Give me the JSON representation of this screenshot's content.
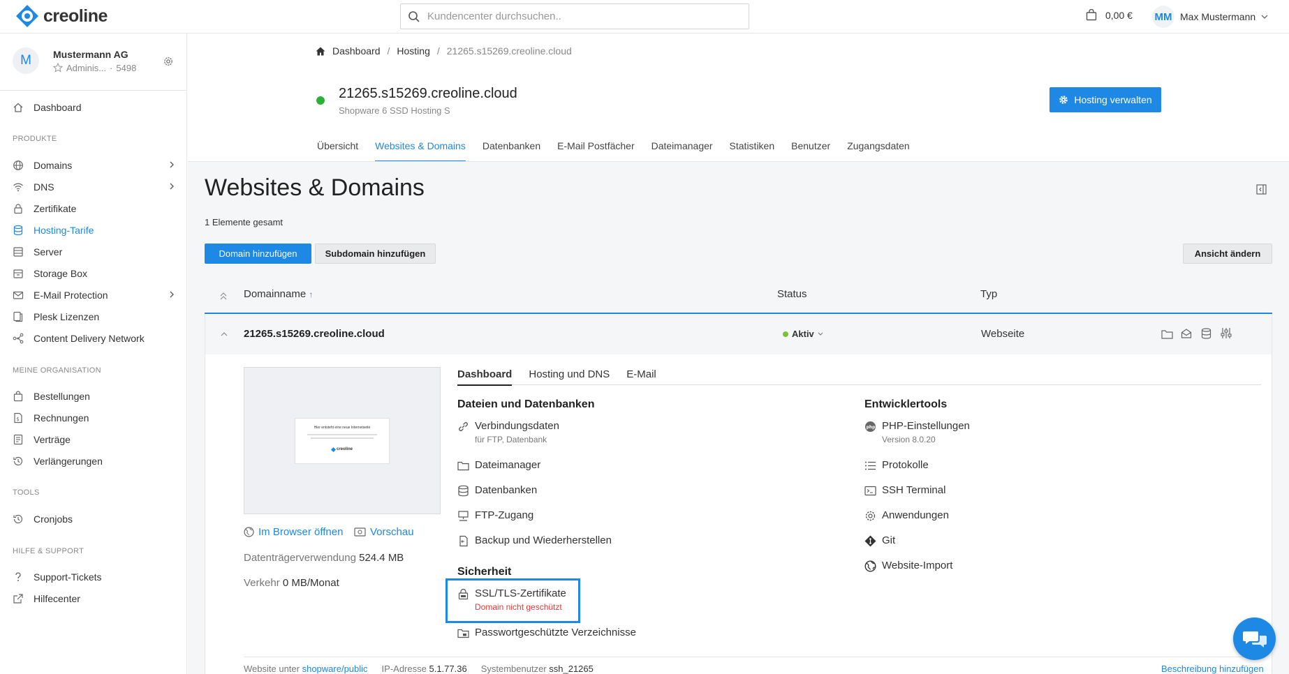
{
  "app": {
    "brand": "creoline",
    "accent": "#1e88e5"
  },
  "header": {
    "search_placeholder": "Kundencenter durchsuchen..",
    "cart_amount": "0,00 €",
    "user_initials": "MM",
    "user_name": "Max Mustermann"
  },
  "sidebar": {
    "org_initial": "M",
    "org_name": "Mustermann AG",
    "org_role": "Adminis...",
    "org_sep": "·",
    "org_id": "5498",
    "dashboard": "Dashboard",
    "section_products": "PRODUKTE",
    "domains": "Domains",
    "dns": "DNS",
    "certificates": "Zertifikate",
    "hosting": "Hosting-Tarife",
    "server": "Server",
    "storage": "Storage Box",
    "email_protection": "E-Mail Protection",
    "plesk": "Plesk Lizenzen",
    "cdn": "Content Delivery Network",
    "section_org": "MEINE ORGANISATION",
    "orders": "Bestellungen",
    "invoices": "Rechnungen",
    "contracts": "Verträge",
    "renewals": "Verlängerungen",
    "section_tools": "TOOLS",
    "cronjobs": "Cronjobs",
    "section_help": "HILFE & SUPPORT",
    "tickets": "Support-Tickets",
    "helpcenter": "Hilfecenter"
  },
  "breadcrumb": {
    "home": "Dashboard",
    "sep": "/",
    "hosting": "Hosting",
    "current": "21265.s15269.creoline.cloud"
  },
  "hosting": {
    "status_color": "#2bb039",
    "title": "21265.s15269.creoline.cloud",
    "subtitle": "Shopware 6 SSD Hosting S",
    "manage_button": "Hosting verwalten"
  },
  "tabs": [
    "Übersicht",
    "Websites & Domains",
    "Datenbanken",
    "E-Mail Postfächer",
    "Dateimanager",
    "Statistiken",
    "Benutzer",
    "Zugangsdaten"
  ],
  "page": {
    "title": "Websites & Domains",
    "count": "1 Elemente gesamt",
    "add_domain": "Domain hinzufügen",
    "add_subdomain": "Subdomain hinzufügen",
    "change_view": "Ansicht ändern"
  },
  "table": {
    "col_domain": "Domainname",
    "sort_arrow": "↑",
    "col_status": "Status",
    "col_type": "Typ",
    "row": {
      "domain": "21265.s15269.creoline.cloud",
      "status": "Aktiv",
      "type": "Webseite"
    }
  },
  "preview": {
    "card_title": "Hier entsteht eine neue Internetseite",
    "card_brand": "creoline"
  },
  "links": {
    "open_browser": "Im Browser öffnen",
    "preview": "Vorschau",
    "disk_label": "Datenträgerverwendung",
    "disk_value": "524.4 MB",
    "traffic_label": "Verkehr",
    "traffic_value": "0 MB/Monat"
  },
  "detail_tabs": [
    "Dashboard",
    "Hosting und DNS",
    "E-Mail"
  ],
  "files_section": {
    "title": "Dateien und Datenbanken",
    "connection": "Verbindungsdaten",
    "connection_sub": "für FTP, Datenbank",
    "filemanager": "Dateimanager",
    "databases": "Datenbanken",
    "ftp": "FTP-Zugang",
    "backup": "Backup und Wiederherstellen"
  },
  "dev_section": {
    "title": "Entwicklertools",
    "php": "PHP-Einstellungen",
    "php_sub": "Version 8.0.20",
    "logs": "Protokolle",
    "ssh": "SSH Terminal",
    "apps": "Anwendungen",
    "git": "Git",
    "import": "Website-Import"
  },
  "security_section": {
    "title": "Sicherheit",
    "ssl": "SSL/TLS-Zertifikate",
    "ssl_sub": "Domain nicht geschützt",
    "protected_dirs": "Passwortgeschützte Verzeichnisse"
  },
  "footer": {
    "website_label": "Website unter",
    "website_value": "shopware/public",
    "ip_label": "IP-Adresse",
    "ip_value": "5.1.77.36",
    "user_label": "Systembenutzer",
    "user_value": "ssh_21265",
    "add_description": "Beschreibung hinzufügen"
  }
}
